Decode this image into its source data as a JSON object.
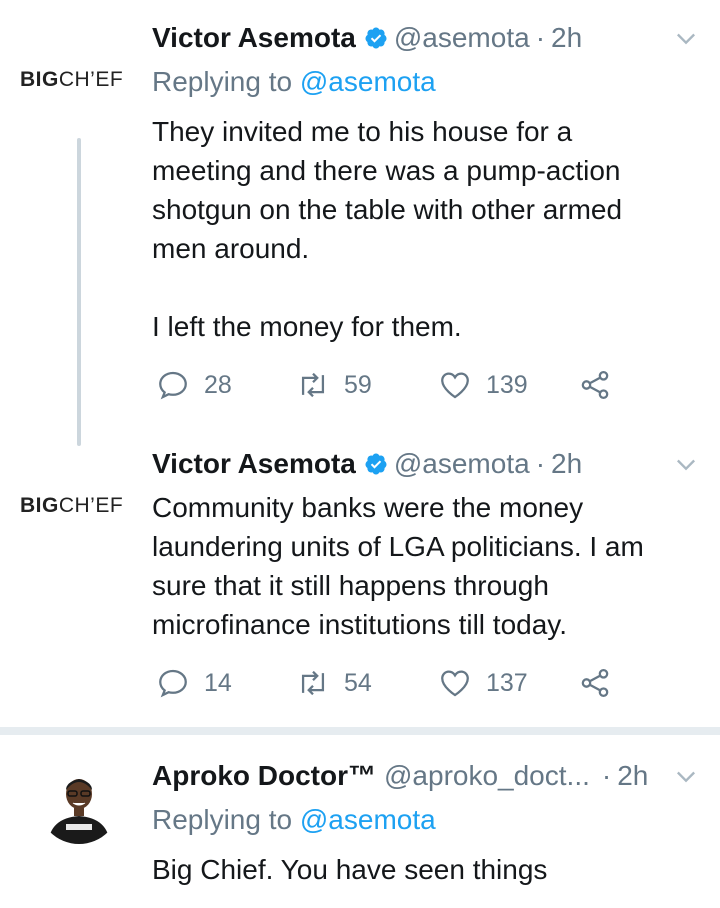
{
  "tweets": [
    {
      "avatar_brand_big": "BIG",
      "avatar_brand_chief": "CH’EF",
      "author_name": "Victor Asemota",
      "handle": "@asemota",
      "separator": "·",
      "time": "2h",
      "replying_prefix": "Replying to ",
      "replying_mention": "@asemota",
      "text": "They invited me to his house for a\nmeeting and there was a pump-action\nshotgun on the table with other armed\nmen around.\n\nI left the money for them.",
      "replies": "28",
      "retweets": "59",
      "likes": "139"
    },
    {
      "avatar_brand_big": "BIG",
      "avatar_brand_chief": "CH’EF",
      "author_name": "Victor Asemota",
      "handle": "@asemota",
      "separator": "·",
      "time": "2h",
      "text": "Community banks were the money\nlaundering units of LGA politicians. I am\nsure that it still happens through\nmicrofinance institutions till today.",
      "replies": "14",
      "retweets": "54",
      "likes": "137"
    },
    {
      "author_name": "Aproko Doctor™",
      "handle": "@aproko_doct...",
      "separator": "·",
      "time": "2h",
      "replying_prefix": "Replying to ",
      "replying_mention": "@asemota",
      "text": "Big Chief. You have seen things"
    }
  ],
  "colors": {
    "text": "#14171a",
    "secondary": "#657786",
    "accent": "#1da1f2",
    "divider": "#e6ecf0"
  },
  "icons": [
    "verified-badge-icon",
    "chevron-down-icon",
    "reply-icon",
    "retweet-icon",
    "like-icon",
    "share-icon"
  ]
}
